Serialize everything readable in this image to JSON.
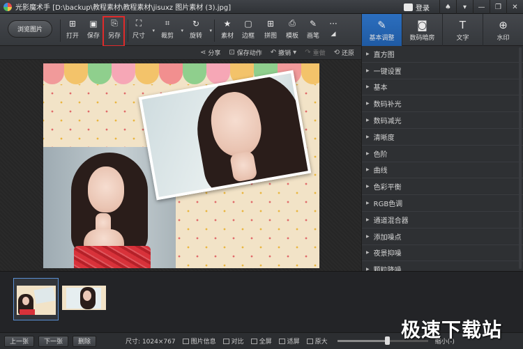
{
  "titlebar": {
    "app_name": "光影魔术手",
    "file_path": "[D:\\backup\\教程素材\\教程素材\\jisuxz 图片素材 (3).jpg]",
    "login_label": "登录",
    "window_buttons": [
      "shirt-icon",
      "menu-icon",
      "minimize-icon",
      "restore-icon",
      "close-icon"
    ]
  },
  "toolbar": {
    "browse_label": "浏览图片",
    "tools": [
      {
        "label": "打开",
        "icon": "open-icon",
        "glyph": "⊞"
      },
      {
        "label": "保存",
        "icon": "save-icon",
        "glyph": "▣"
      },
      {
        "label": "另存",
        "icon": "save-as-icon",
        "glyph": "⎘"
      },
      {
        "label": "尺寸",
        "icon": "resize-icon",
        "glyph": "⛶"
      },
      {
        "label": "裁剪",
        "icon": "crop-icon",
        "glyph": "⌗"
      },
      {
        "label": "旋转",
        "icon": "rotate-icon",
        "glyph": "↻"
      },
      {
        "label": "素材",
        "icon": "material-icon",
        "glyph": "★"
      },
      {
        "label": "边框",
        "icon": "border-icon",
        "glyph": "▢"
      },
      {
        "label": "拼图",
        "icon": "collage-icon",
        "glyph": "⊞"
      },
      {
        "label": "模板",
        "icon": "template-icon",
        "glyph": "⎙"
      },
      {
        "label": "画笔",
        "icon": "brush-icon",
        "glyph": "✎"
      },
      {
        "label": "",
        "icon": "more-icon",
        "glyph": "···"
      }
    ]
  },
  "panel_tabs": [
    {
      "label": "基本调整",
      "icon": "basic-adjust-icon",
      "glyph": "✎"
    },
    {
      "label": "数码暗房",
      "icon": "darkroom-icon",
      "glyph": "◙"
    },
    {
      "label": "文字",
      "icon": "text-icon",
      "glyph": "T"
    },
    {
      "label": "水印",
      "icon": "watermark-icon",
      "glyph": "⊕"
    }
  ],
  "actionbar": {
    "share": "分享",
    "save_action": "保存动作",
    "undo": "撤销",
    "redo": "重做",
    "restore": "还原"
  },
  "adjust_panel": {
    "items": [
      "直方图",
      "一键设置",
      "基本",
      "数码补光",
      "数码减光",
      "清晰度",
      "色阶",
      "曲线",
      "色彩平衡",
      "RGB色调",
      "通道混合器",
      "添加噪点",
      "夜景抑噪",
      "颗粒降噪"
    ]
  },
  "bottombar": {
    "prev": "上一张",
    "next": "下一张",
    "delete": "删除",
    "size_info": "尺寸: 1024×767",
    "image_info": "图片信息",
    "compare": "对比",
    "fullscreen": "全屏",
    "fit": "适屏",
    "original": "原大",
    "zoom_out": "缩小(-)"
  },
  "zoom": {
    "level": 0.55
  },
  "watermark_text": "极速下载站",
  "colors": {
    "accent": "#2c6fbf",
    "highlight_box": "#e02a2a"
  }
}
